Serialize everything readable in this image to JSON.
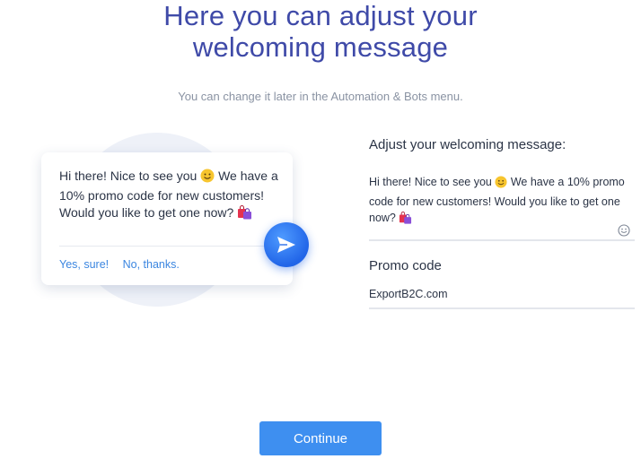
{
  "header": {
    "title_line1": "Here you can adjust your",
    "title_line2": "welcoming message",
    "subtitle": "You can change it later in the Automation & Bots menu."
  },
  "preview": {
    "message_part1": "Hi there! Nice to see you ",
    "message_part2": " We have a 10% promo code for new customers! Would you like to get one now? ",
    "reply_yes": "Yes, sure!",
    "reply_no": "No, thanks.",
    "icons": [
      "slightly-smiling-face-emoji",
      "shopping-bags-emoji",
      "send-icon"
    ]
  },
  "form": {
    "welcome_label": "Adjust your welcoming message:",
    "welcome_value_part1": "Hi there! Nice to see you ",
    "welcome_value_part2": " We have a 10% promo code for new customers! Would you like to get one now? ",
    "promo_label": "Promo code",
    "promo_value": "ExportB2C.com"
  },
  "actions": {
    "continue_label": "Continue"
  },
  "colors": {
    "title": "#3f4aa8",
    "accent": "#3e8ff0",
    "link": "#3b86e0",
    "send_button": "#2165e8"
  }
}
